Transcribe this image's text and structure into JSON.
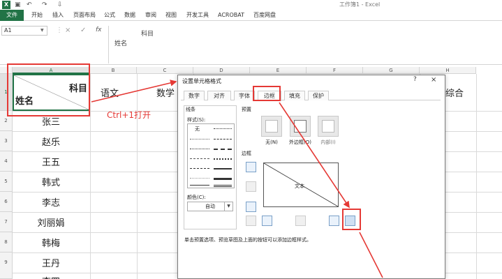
{
  "titlebar": {
    "app_logo": "X",
    "window_title": "工作簿1 - Excel",
    "qat": [
      "save-icon",
      "undo-icon",
      "redo-icon",
      "customize-icon"
    ]
  },
  "ribbon": {
    "tabs": [
      "文件",
      "开始",
      "插入",
      "页面布局",
      "公式",
      "数据",
      "审阅",
      "视图",
      "开发工具",
      "ACROBAT",
      "百度网盘"
    ]
  },
  "formula_bar": {
    "name_box": "A1",
    "cancel": "×",
    "enter": "✓",
    "fx": "fx",
    "content_line1": "科目",
    "content_line2": "姓名"
  },
  "columns": [
    "A",
    "B",
    "C",
    "D",
    "E",
    "F",
    "G",
    "H"
  ],
  "rows": [
    "1",
    "2",
    "3",
    "4",
    "5",
    "6",
    "7",
    "8",
    "9"
  ],
  "cell_a1": {
    "top_right": "科目",
    "bottom_left": "姓名"
  },
  "header_row": {
    "b": "语文",
    "c": "数学",
    "h": "综合"
  },
  "names": [
    "张三",
    "赵乐",
    "王五",
    "韩式",
    "李志",
    "刘丽娟",
    "韩梅",
    "王丹",
    "李四"
  ],
  "annotation": "Ctrl+1打开",
  "dialog": {
    "title": "设置单元格格式",
    "help": "?",
    "close": "×",
    "tabs": [
      "数字",
      "对齐",
      "字体",
      "边框",
      "填充",
      "保护"
    ],
    "active_tab": "边框",
    "line_section": "线条",
    "style_label": "样式(S):",
    "style_none": "无",
    "color_label": "颜色(C):",
    "color_value": "自动",
    "preset_section": "预置",
    "presets": [
      "无(N)",
      "外边框(O)",
      "内部(I)"
    ],
    "border_section": "边框",
    "preview_text": "文本",
    "hint": "单击预置选项、预览草图及上面的按钮可以添加边框样式。"
  },
  "colors": {
    "excel_green": "#217346",
    "annotation_red": "#e53935"
  }
}
